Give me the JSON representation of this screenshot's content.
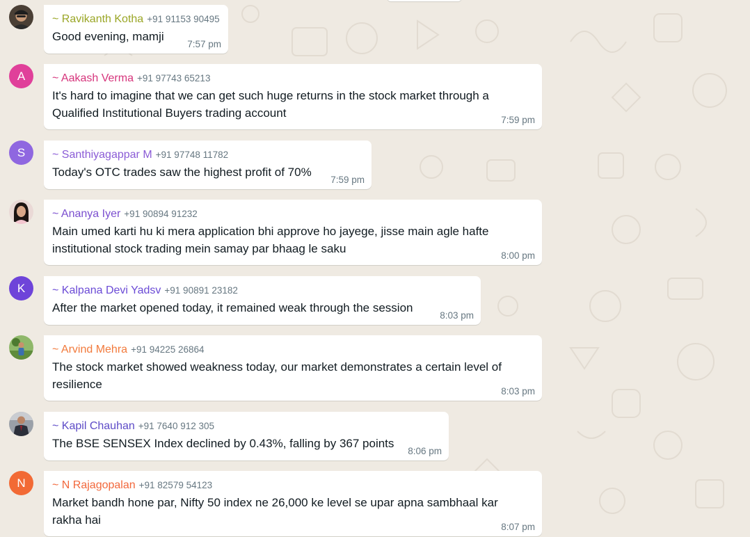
{
  "chat": {
    "messages": [
      {
        "sender": "~ Ravikanth Kotha",
        "phone": "+91 91153 90495",
        "text_lines": [
          "Good evening, mamji"
        ],
        "time": "7:57 pm",
        "name_color": "#9aa626",
        "avatar": {
          "type": "photo",
          "icon": "profile-photo-man-cap",
          "bg": "#5a4a3a"
        }
      },
      {
        "sender": "~ Aakash Verma",
        "phone": "+91 97743 65213",
        "text_lines": [
          "It's hard to imagine that we can get such huge returns in the stock market through a",
          "Qualified Institutional Buyers trading account"
        ],
        "time": "7:59 pm",
        "name_color": "#d6357c",
        "avatar": {
          "type": "letter",
          "letter": "A",
          "bg": "#e0409a"
        }
      },
      {
        "sender": "~ Santhiyagappar M",
        "phone": "+91 97748 11782",
        "text_lines": [
          "Today's OTC trades saw the highest profit of 70%"
        ],
        "time": "7:59 pm",
        "name_color": "#8b5cd6",
        "avatar": {
          "type": "letter",
          "letter": "S",
          "bg": "#8f67e0"
        }
      },
      {
        "sender": "~ Ananya Iyer",
        "phone": "+91 90894 91232",
        "text_lines": [
          "Main umed karti hu ki mera application bhi approve ho jayege, jisse main agle hafte",
          "institutional stock trading mein samay par bhaag le saku"
        ],
        "time": "8:00 pm",
        "name_color": "#7b4fcf",
        "avatar": {
          "type": "photo",
          "icon": "profile-photo-woman",
          "bg": "#e9d8d6"
        }
      },
      {
        "sender": "~ Kalpana Devi Yadsv",
        "phone": "+91 90891 23182",
        "text_lines": [
          "After the market opened today, it remained weak through the session"
        ],
        "time": "8:03 pm",
        "name_color": "#6b4bd6",
        "avatar": {
          "type": "letter",
          "letter": "K",
          "bg": "#6e44d9"
        }
      },
      {
        "sender": "~ Arvind Mehra",
        "phone": "+91 94225 26864",
        "text_lines": [
          "The stock market showed weakness today, our market demonstrates a certain level of",
          "resilience"
        ],
        "time": "8:03 pm",
        "name_color": "#f27a3c",
        "avatar": {
          "type": "photo",
          "icon": "profile-photo-outdoor",
          "bg": "#7fa85a"
        }
      },
      {
        "sender": "~ Kapil Chauhan",
        "phone": "+91 7640 912 305",
        "text_lines": [
          "The BSE SENSEX Index declined by 0.43%, falling by 367 points"
        ],
        "time": "8:06 pm",
        "name_color": "#5d4bc7",
        "avatar": {
          "type": "photo",
          "icon": "profile-photo-man-suit",
          "bg": "#8a8f99"
        }
      },
      {
        "sender": "~ N Rajagopalan",
        "phone": "+91 82579 54123",
        "text_lines": [
          "Market bandh hone par, Nifty 50 index ne 26,000 ke level se upar apna sambhaal kar",
          "rakha hai"
        ],
        "time": "8:07 pm",
        "name_color": "#f2683c",
        "avatar": {
          "type": "letter",
          "letter": "N",
          "bg": "#f26a35"
        }
      }
    ]
  }
}
